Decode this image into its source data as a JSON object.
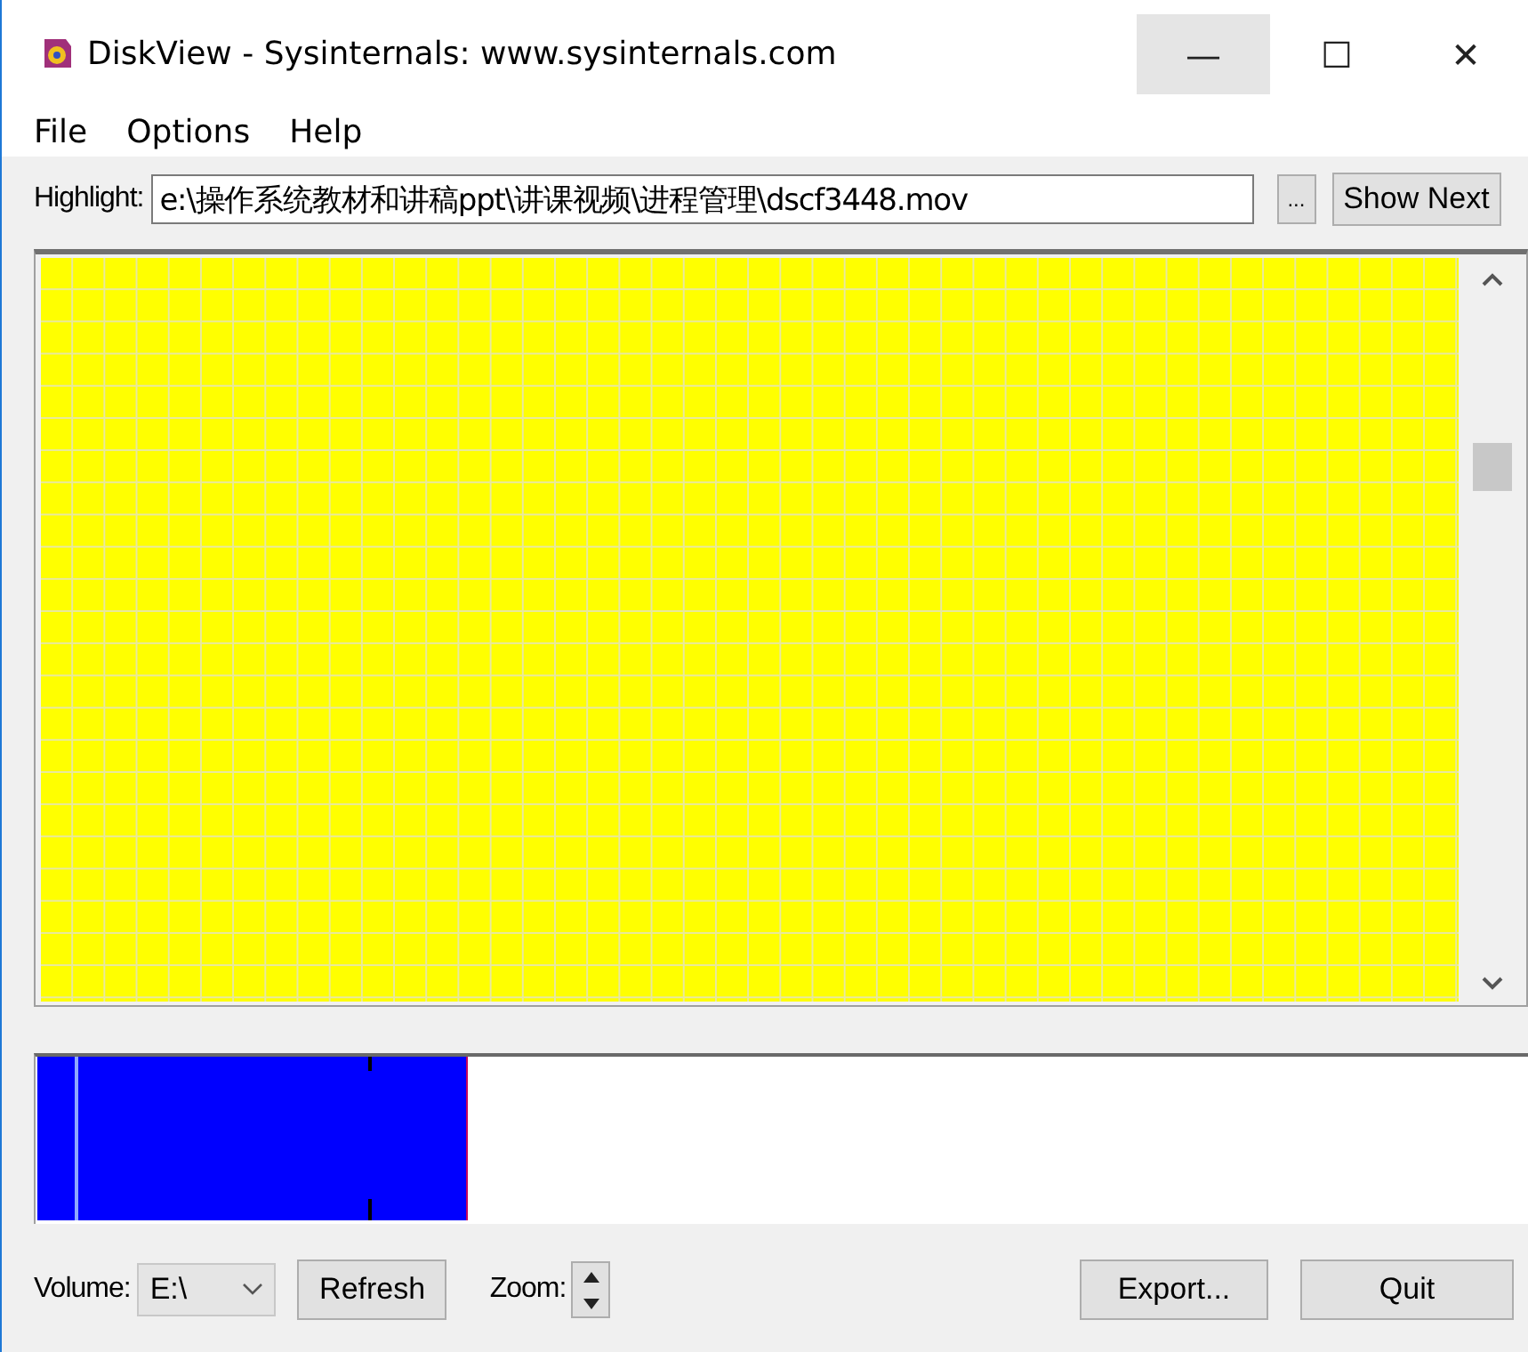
{
  "window": {
    "title": "DiskView - Sysinternals: www.sysinternals.com",
    "controls": [
      "—",
      "☐",
      "✕"
    ]
  },
  "menu": [
    "File",
    "Options",
    "Help"
  ],
  "highlight": {
    "label": "Highlight:",
    "value": "e:\\操作系统教材和讲稿ppt\\讲课视频\\进程管理\\dscf3448.mov",
    "browse": "...",
    "show_next": "Show Next"
  },
  "bottom": {
    "volume_label": "Volume:",
    "volume": "E:\\",
    "refresh": "Refresh",
    "zoom_label": "Zoom:",
    "export": "Export...",
    "quit": "Quit"
  }
}
